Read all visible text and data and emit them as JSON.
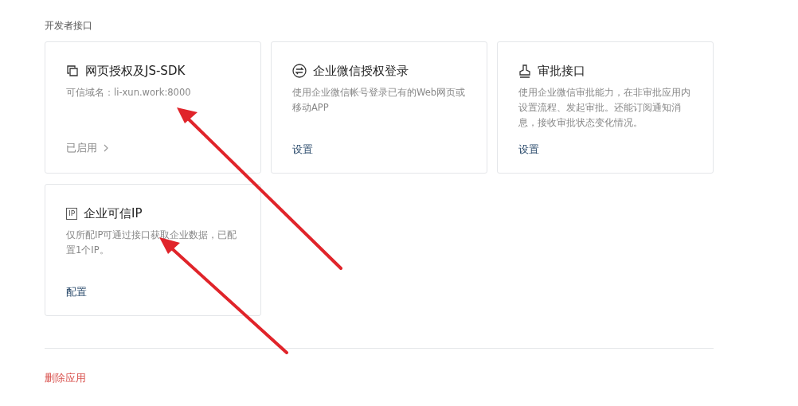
{
  "section_title": "开发者接口",
  "cards": [
    {
      "kind": "copy",
      "title": "网页授权及JS-SDK",
      "description": "可信域名：li-xun.work:8000",
      "action": {
        "kind": "status",
        "label": "已启用"
      }
    },
    {
      "kind": "exchange",
      "title": "企业微信授权登录",
      "description": "使用企业微信帐号登录已有的Web网页或移动APP",
      "action": {
        "kind": "link",
        "label": "设置"
      }
    },
    {
      "kind": "stamp",
      "title": "审批接口",
      "description": "使用企业微信审批能力，在非审批应用内设置流程、发起审批。还能订阅通知消息，接收审批状态变化情况。",
      "action": {
        "kind": "link",
        "label": "设置"
      }
    },
    {
      "kind": "tag",
      "icon_text": "IP",
      "title": "企业可信IP",
      "description": "仅所配IP可通过接口获取企业数据，已配置1个IP。",
      "action": {
        "kind": "link",
        "label": "配置"
      }
    }
  ],
  "delete_link": "删除应用"
}
